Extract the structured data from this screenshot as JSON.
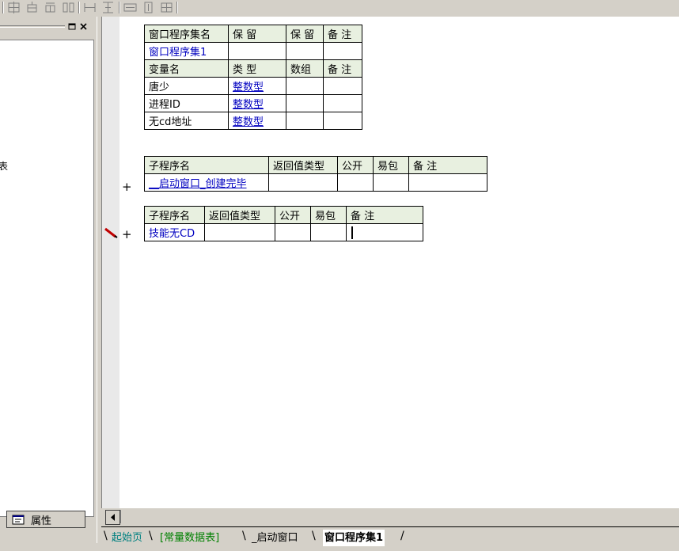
{
  "toolbar": {
    "icons": [
      "align-grid-icon",
      "align-top-icon",
      "align-middle-icon",
      "align-spread-icon",
      "horizontal-spacing-icon",
      "vertical-spacing-icon",
      "same-width-icon",
      "same-height-icon",
      "same-size-icon"
    ]
  },
  "left_panel": {
    "fragment_text": "表",
    "properties_tab_label": "属性"
  },
  "window_set_table": {
    "headers": [
      "窗口程序集名",
      "保 留",
      "保 留",
      "备 注"
    ],
    "row": [
      "窗口程序集1",
      "",
      "",
      ""
    ]
  },
  "variables_table": {
    "headers": [
      "变量名",
      "类 型",
      "数组",
      "备 注"
    ],
    "rows": [
      [
        "唐少",
        "整数型",
        "",
        ""
      ],
      [
        "进程ID",
        "整数型",
        "",
        ""
      ],
      [
        "无cd地址",
        "整数型",
        "",
        ""
      ]
    ]
  },
  "sub1_table": {
    "headers": [
      "子程序名",
      "返回值类型",
      "公开",
      "易包",
      "备 注"
    ],
    "row": [
      "__启动窗口_创建完毕",
      "",
      "",
      "",
      ""
    ],
    "marker": "+"
  },
  "sub2_table": {
    "headers": [
      "子程序名",
      "返回值类型",
      "公开",
      "易包",
      "备 注"
    ],
    "row": [
      "技能无CD",
      "",
      "",
      "",
      ""
    ],
    "marker": "+"
  },
  "bottom_tabs": [
    {
      "label": "起始页",
      "active": false
    },
    {
      "label": "[常量数据表]",
      "active": false
    },
    {
      "label": "_启动窗口",
      "active": false
    },
    {
      "label": "窗口程序集1",
      "active": true
    }
  ],
  "colors": {
    "background": "#d4d0c8",
    "header_bg": "#e8f0e0",
    "type_text": "#0000c0",
    "tab_teal": "#008080",
    "tab_green": "#008000"
  }
}
